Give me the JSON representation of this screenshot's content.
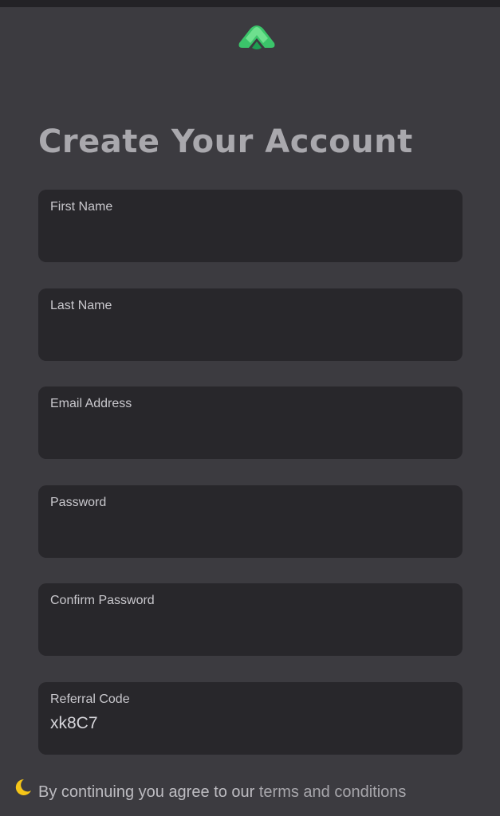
{
  "header": {
    "logo_icon": "green-stacked-chevron-logo",
    "brand_colors": [
      "#6ee08e",
      "#3bc46a",
      "#1f9e52"
    ]
  },
  "page": {
    "title": "Create Your Account"
  },
  "form": {
    "first_name": {
      "label": "First Name",
      "value": ""
    },
    "last_name": {
      "label": "Last Name",
      "value": ""
    },
    "email": {
      "label": "Email Address",
      "value": ""
    },
    "password": {
      "label": "Password",
      "value": ""
    },
    "confirm_password": {
      "label": "Confirm Password",
      "value": ""
    },
    "referral_code": {
      "label": "Referral Code",
      "value": "xk8C7"
    }
  },
  "footer": {
    "theme_icon": "moon-icon",
    "theme_icon_color": "#f5c518",
    "agree_prefix": "By continuing you agree to our ",
    "terms_link": "terms and conditions"
  }
}
